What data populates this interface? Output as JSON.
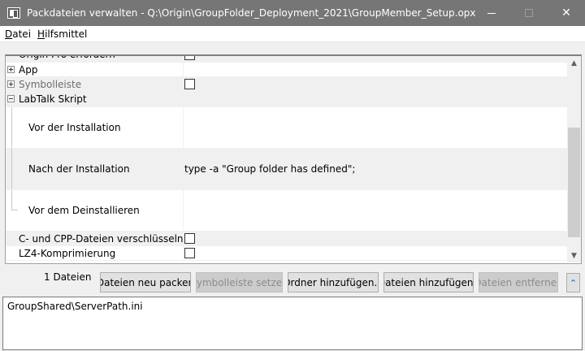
{
  "window": {
    "title": "Packdateien verwalten - Q:\\Origin\\GroupFolder_Deployment_2021\\GroupMember_Setup.opx",
    "minimize_icon": "minimize-icon",
    "maximize_icon": "maximize-icon",
    "close_icon": "close-icon",
    "close_glyph": "✕"
  },
  "menu": {
    "items": [
      {
        "accel": "D",
        "rest": "atei"
      },
      {
        "accel": "H",
        "rest": "ilfsmittel"
      }
    ]
  },
  "grid": {
    "rows": [
      {
        "name": "Origin Pro erfordern",
        "type": "checkbox",
        "checked": false
      },
      {
        "name": "App",
        "type": "category",
        "expanded": false
      },
      {
        "name": "Symbolleiste",
        "type": "category",
        "expanded": false,
        "checked": false
      },
      {
        "name": "LabTalk Skript",
        "type": "category",
        "expanded": true
      },
      {
        "name": "Vor der Installation",
        "value": ""
      },
      {
        "name": "Nach der Installation",
        "value": "type -a \"Group folder has defined\";"
      },
      {
        "name": "Vor dem Deinstallieren",
        "value": ""
      },
      {
        "name": "C- und CPP-Dateien verschlüsseln",
        "type": "checkbox",
        "checked": false
      },
      {
        "name": "LZ4-Komprimierung",
        "type": "checkbox",
        "checked": false
      }
    ]
  },
  "bottom": {
    "count_label": "1 Dateien",
    "buttons": {
      "repack": "Dateien neu packen",
      "set_toolbar": "Symbolleiste setzen",
      "add_folder": "Ordner hinzufügen...",
      "add_files": "Dateien hinzufügen..",
      "remove_files": "Dateien entfernen",
      "collapse_glyph": "⌃"
    }
  },
  "files": [
    "GroupShared\\ServerPath.ini"
  ],
  "colors": {
    "titlebar": "#767676",
    "accent": "#1a57c9"
  }
}
